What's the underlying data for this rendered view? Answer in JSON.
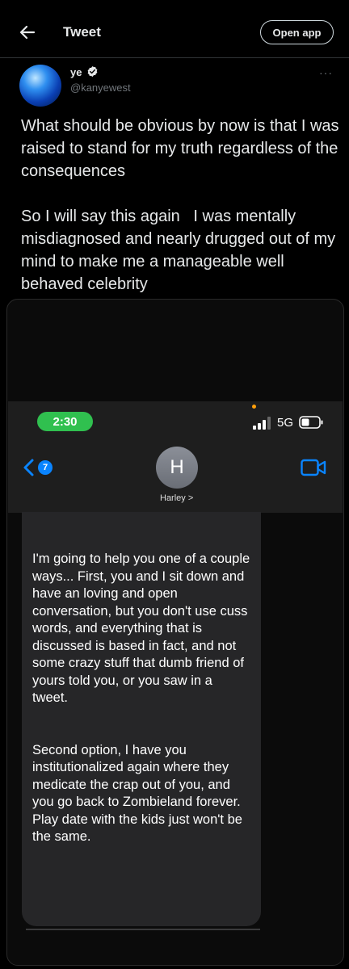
{
  "header": {
    "title": "Tweet",
    "open_app_label": "Open app"
  },
  "tweet": {
    "author_name": "ye",
    "author_handle": "@kanyewest",
    "verified": true,
    "more_label": "···",
    "text": "What should be obvious by now is that I was raised to stand for my truth regardless of the consequences\n\nSo I will say this again   I was mentally misdiagnosed and nearly drugged out of my mind to make me a manageable well behaved celebrity"
  },
  "screenshot": {
    "time": "2:30",
    "network": "5G",
    "back_count": "7",
    "contact_initial": "H",
    "contact_name": "Harley >",
    "message": "I'm going to help you one of a couple ways... First, you and I sit down and have an loving and open  conversation, but you don't use cuss words, and everything that is discussed is based in fact, and not some crazy stuff that dumb friend of yours told you, or you saw in a tweet.\n\n\nSecond option, I have you institutionalized again where they medicate the crap out of you, and you go back to Zombieland forever. Play date with the kids just won't be the same."
  },
  "colors": {
    "background": "#000000",
    "text_primary": "#e7e9ea",
    "text_secondary": "#71767b",
    "verified_badge": "#e7e9ea",
    "clock_pill": "#30c04f",
    "ios_blue": "#0a84ff",
    "bubble": "#262628"
  },
  "icons": {
    "back": "back-arrow-icon",
    "verified": "verified-badge-icon",
    "more": "more-dots-icon",
    "signal": "signal-bars-icon",
    "battery": "battery-icon",
    "messages_back": "chevron-left-icon",
    "video": "video-camera-icon"
  }
}
